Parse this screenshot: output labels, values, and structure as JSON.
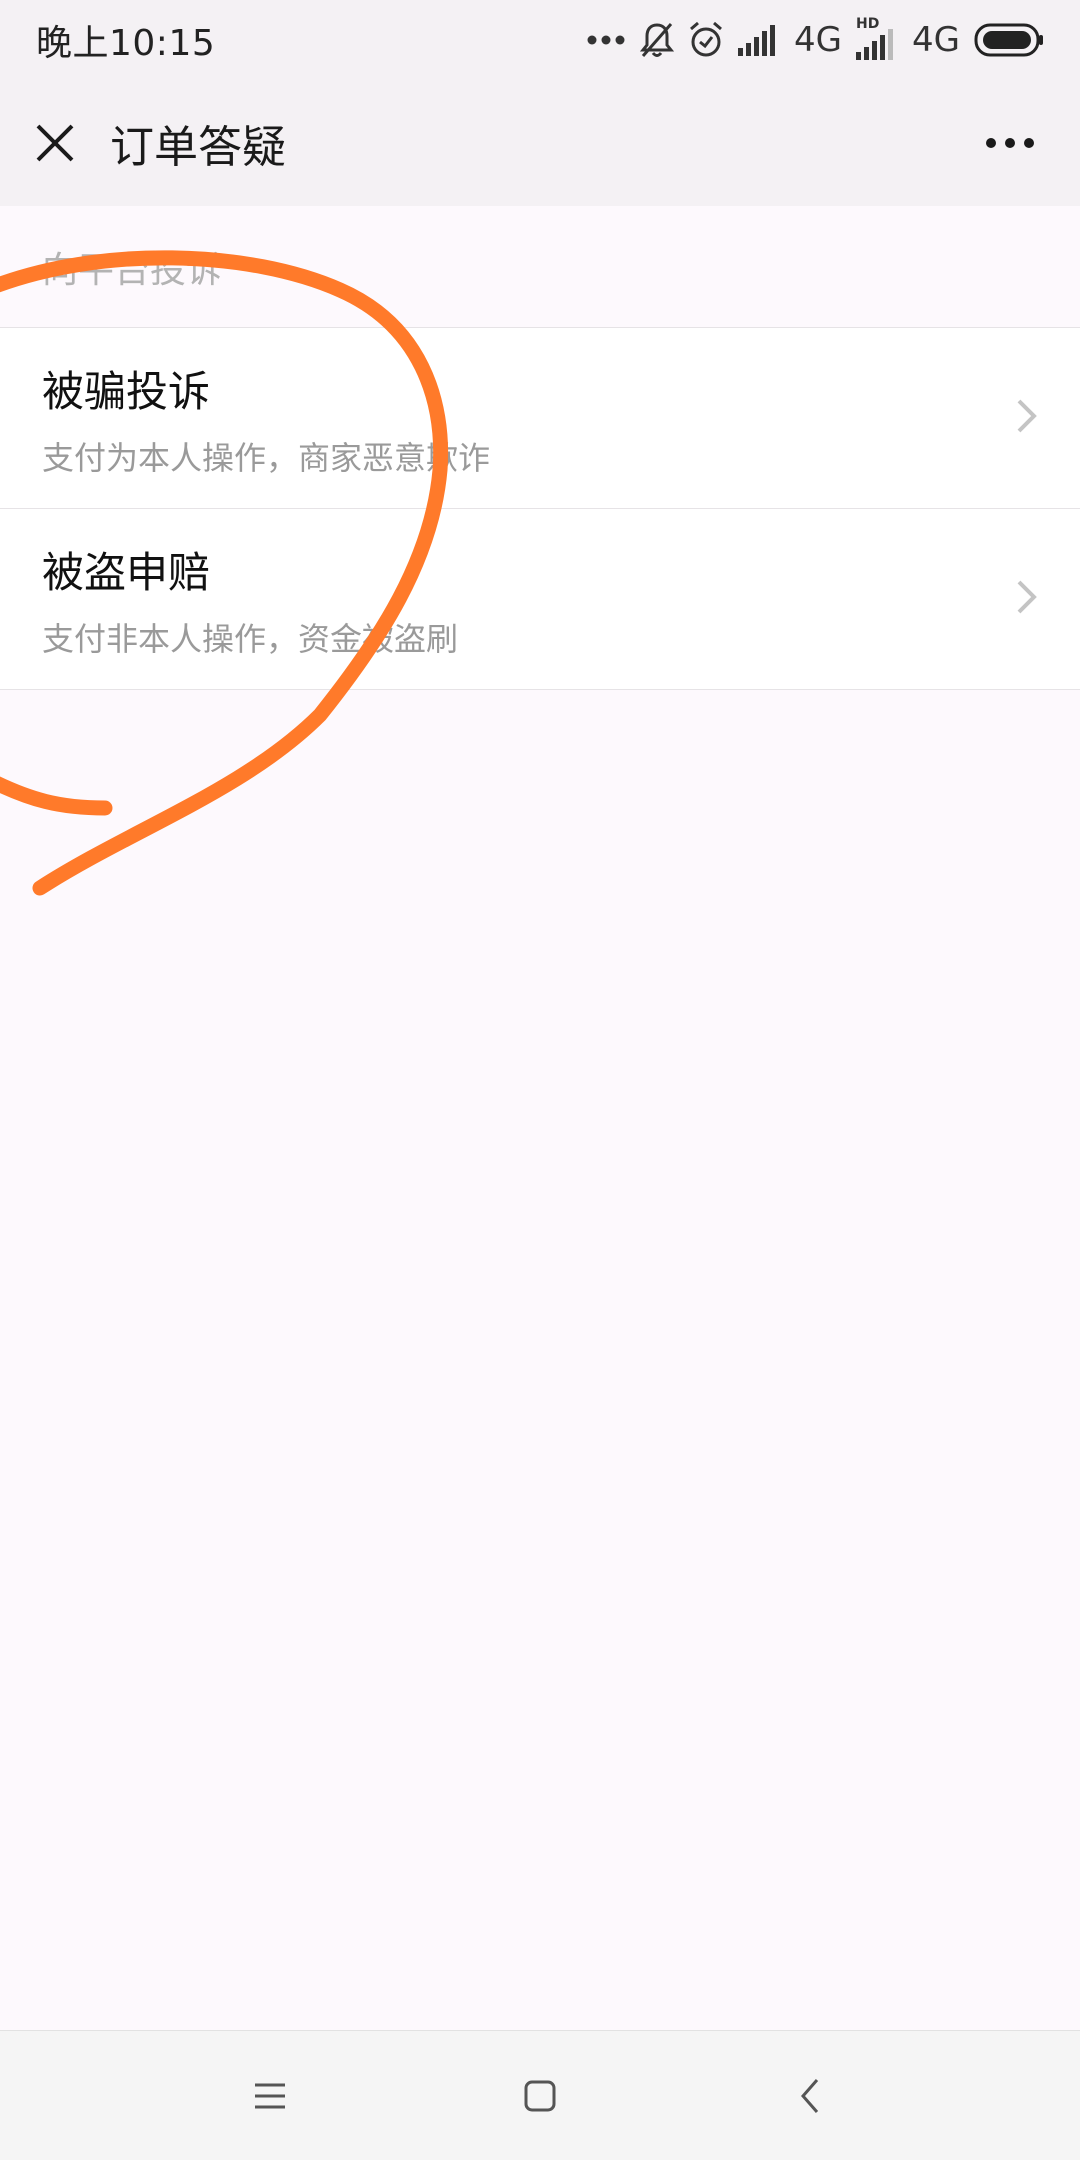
{
  "status_bar": {
    "time": "晚上10:15",
    "network_1": "4G",
    "network_2": "4G",
    "hd_label": "HD",
    "icons": [
      "more-dots-icon",
      "notification-muted-icon",
      "alarm-icon",
      "signal-icon",
      "hd-signal-icon",
      "battery-icon"
    ]
  },
  "header": {
    "title": "订单答疑",
    "close_icon": "close-icon",
    "more_icon": "more-dots-icon"
  },
  "section": {
    "title": "向平台投诉"
  },
  "list": [
    {
      "title": "被骗投诉",
      "description": "支付为本人操作，商家恶意欺诈",
      "icon": "chevron-right-icon"
    },
    {
      "title": "被盗申赔",
      "description": "支付非本人操作，资金被盗刷",
      "icon": "chevron-right-icon"
    }
  ],
  "nav_bar": {
    "icons": [
      "menu-icon",
      "home-icon",
      "back-icon"
    ]
  },
  "colors": {
    "scribble": "#ff7a2a",
    "background": "#fdf9fd",
    "header_bg": "#f4f1f4",
    "muted_text": "#9a9a9a"
  }
}
